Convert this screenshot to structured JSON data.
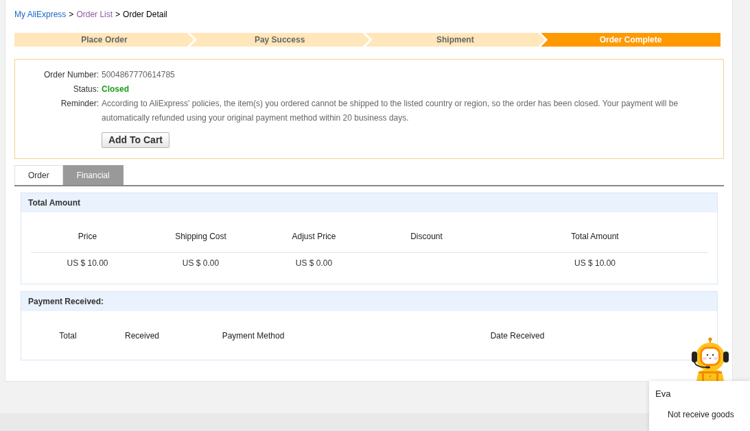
{
  "breadcrumb": [
    {
      "kind": "link",
      "label": "My AliExpress",
      "visited": false
    },
    {
      "kind": "separator",
      "label": ">"
    },
    {
      "kind": "link",
      "label": "Order List",
      "visited": true
    },
    {
      "kind": "separator",
      "label": ">"
    },
    {
      "kind": "current",
      "label": "Order Detail"
    }
  ],
  "steps": [
    {
      "label": "Place Order",
      "current": false
    },
    {
      "label": "Pay Success",
      "current": false
    },
    {
      "label": "Shipment",
      "current": false
    },
    {
      "label": "Order Complete",
      "current": true
    }
  ],
  "order_info": {
    "rows": [
      {
        "label": "Order Number:",
        "value": "5004867770614785",
        "kind": "text"
      },
      {
        "label": "Status:",
        "value": "Closed",
        "kind": "status"
      },
      {
        "label": "Reminder:",
        "value": "According to AliExpress' policies, the item(s) you ordered cannot be shipped to the listed country or region, so the order has been closed. Your payment will be automatically refunded using your original payment method within 20 business days.",
        "kind": "text"
      }
    ],
    "button": "Add To Cart"
  },
  "tabs": [
    {
      "label": "Order",
      "selected": false
    },
    {
      "label": "Financial",
      "selected": true
    }
  ],
  "total_amount": {
    "title": "Total Amount",
    "columns": [
      {
        "header": "Price",
        "value": "US $ 10.00"
      },
      {
        "header": "Shipping Cost",
        "value": "US $ 0.00"
      },
      {
        "header": "Adjust Price",
        "value": "US $ 0.00"
      },
      {
        "header": "Discount"
      },
      {
        "header": "Total Amount",
        "value": "US $ 10.00"
      }
    ]
  },
  "payment_received": {
    "title": "Payment Received:",
    "columns": [
      "Total",
      "Received",
      "Payment Method",
      "Date Received"
    ]
  },
  "chat": {
    "title": "Eva",
    "items": [
      "Not receive goods"
    ]
  }
}
